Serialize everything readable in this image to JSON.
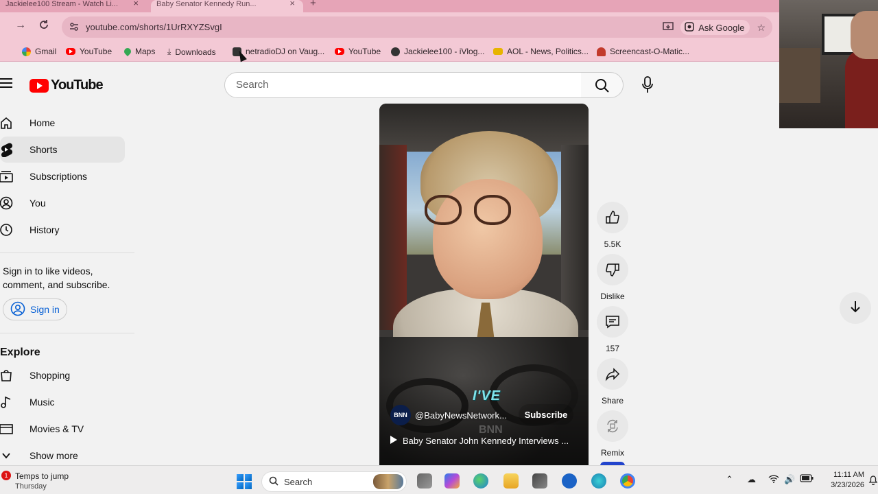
{
  "browser": {
    "tabs": [
      {
        "title": "Jackielee100 Stream - Watch Li..."
      },
      {
        "title": "Baby Senator Kennedy Run..."
      }
    ],
    "new_tab": "+",
    "url": "youtube.com/shorts/1UrRXYZSvgI",
    "ask_google": "Ask Google",
    "bookmarks": [
      {
        "label": "Gmail",
        "icon": "gmail-icon"
      },
      {
        "label": "YouTube",
        "icon": "youtube-icon"
      },
      {
        "label": "Maps",
        "icon": "maps-icon"
      },
      {
        "label": "Downloads",
        "icon": "download-icon"
      },
      {
        "label": "netradioDJ on Vaug...",
        "icon": "vaughn-icon"
      },
      {
        "label": "YouTube",
        "icon": "youtube-icon"
      },
      {
        "label": "Jackielee100 - iVlog...",
        "icon": "ivlog-icon"
      },
      {
        "label": "AOL - News, Politics...",
        "icon": "aol-icon"
      },
      {
        "label": "Screencast-O-Matic...",
        "icon": "screencast-icon"
      }
    ]
  },
  "youtube": {
    "logo_text": "YouTube",
    "search_placeholder": "Search",
    "nav": [
      {
        "label": "Home",
        "icon": "home-icon"
      },
      {
        "label": "Shorts",
        "icon": "shorts-icon",
        "active": true
      },
      {
        "label": "Subscriptions",
        "icon": "subscriptions-icon"
      },
      {
        "label": "You",
        "icon": "you-icon"
      },
      {
        "label": "History",
        "icon": "history-icon"
      }
    ],
    "signin_prompt": "Sign in to like videos, comment, and subscribe.",
    "signin_button": "Sign in",
    "explore_heading": "Explore",
    "explore": [
      {
        "label": "Shopping",
        "icon": "shopping-icon"
      },
      {
        "label": "Music",
        "icon": "music-icon"
      },
      {
        "label": "Movies & TV",
        "icon": "movies-icon"
      },
      {
        "label": "Show more",
        "icon": "chevron-down-icon"
      }
    ]
  },
  "short": {
    "overlay_caption": "I'VE",
    "channel_avatar": "BNN",
    "channel_name": "@BabyNewsNetwork...",
    "subscribe": "Subscribe",
    "watermark": "BNN",
    "title": "Baby Senator John Kennedy Interviews ...",
    "actions": [
      {
        "label": "5.5K",
        "icon": "like-icon"
      },
      {
        "label": "Dislike",
        "icon": "dislike-icon"
      },
      {
        "label": "157",
        "icon": "comment-icon"
      },
      {
        "label": "Share",
        "icon": "share-icon"
      },
      {
        "label": "Remix",
        "icon": "remix-icon"
      }
    ]
  },
  "taskbar": {
    "weather_badge": "1",
    "weather_title": "Temps to jump",
    "weather_sub": "Thursday",
    "search_placeholder": "Search",
    "time": "11:11 AM",
    "date": "3/23/2026"
  },
  "colors": {
    "chrome_pink": "#f3c9d5",
    "youtube_red": "#ff0000",
    "link_blue": "#065fd4"
  }
}
